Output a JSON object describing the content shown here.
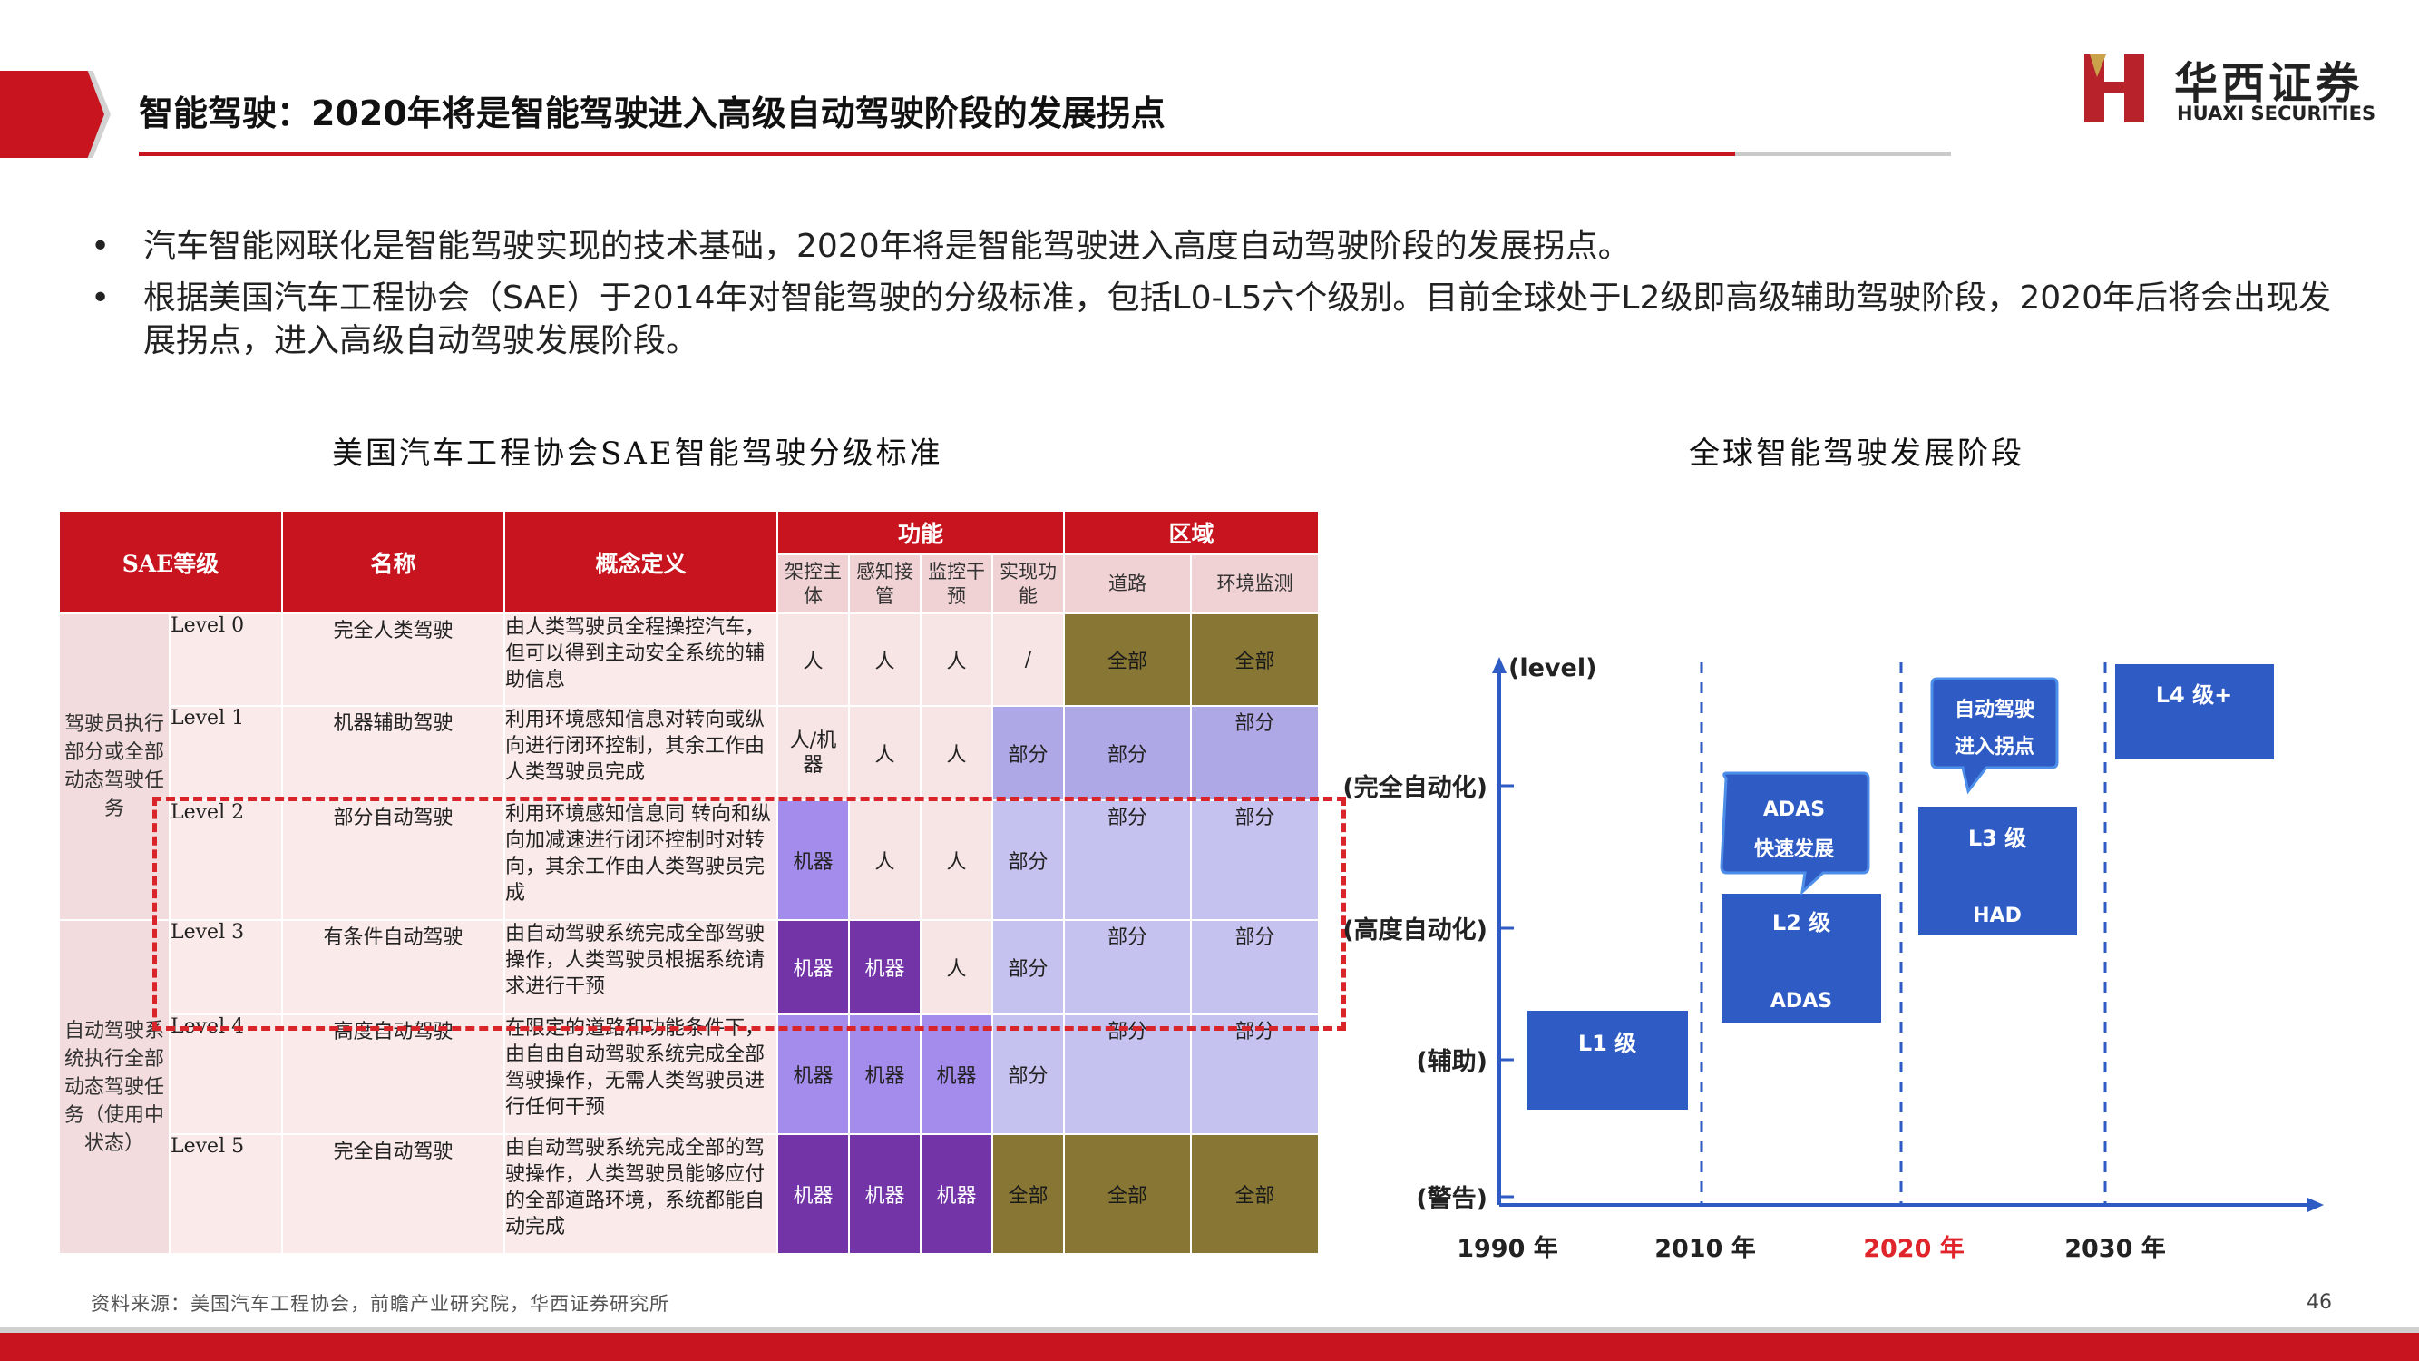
{
  "header": {
    "title": "智能驾驶：2020年将是智能驾驶进入高级自动驾驶阶段的发展拐点",
    "logo_cn": "华西证券",
    "logo_en": "HUAXI SECURITIES"
  },
  "bullets": [
    "汽车智能网联化是智能驾驶实现的技术基础，2020年将是智能驾驶进入高度自动驾驶阶段的发展拐点。",
    "根据美国汽车工程协会（SAE）于2014年对智能驾驶的分级标准，包括L0-L5六个级别。目前全球处于L2级即高级辅助驾驶阶段，2020年后将会出现发展拐点，进入高级自动驾驶发展阶段。"
  ],
  "table": {
    "caption": "美国汽车工程协会SAE智能驾驶分级标准",
    "headers": {
      "level": "SAE等级",
      "name": "名称",
      "definition": "概念定义",
      "function": "功能",
      "region": "区域",
      "sub": [
        "架控主体",
        "感知接管",
        "监控干预",
        "实现功能",
        "道路",
        "环境监测"
      ]
    },
    "groups": [
      "驾驶员执行部分或全部动态驾驶任务",
      "自动驾驶系统执行全部动态驾驶任务（使用中状态）"
    ],
    "rows": [
      {
        "level": "Level 0",
        "name": "完全人类驾驶",
        "def": "由人类驾驶员全程操控汽车，但可以得到主动安全系统的辅助信息",
        "cells": [
          "人",
          "人",
          "人",
          "/",
          "全部",
          "全部"
        ]
      },
      {
        "level": "Level 1",
        "name": "机器辅助驾驶",
        "def": "利用环境感知信息对转向或纵向进行闭环控制，其余工作由人类驾驶员完成",
        "cells": [
          "人/机器",
          "人",
          "人",
          "部分",
          "部分",
          "部分"
        ]
      },
      {
        "level": "Level 2",
        "name": "部分自动驾驶",
        "def": "利用环境感知信息同 转向和纵向加减速进行闭环控制时对转向，其余工作由人类驾驶员完成",
        "cells": [
          "机器",
          "人",
          "人",
          "部分",
          "部分",
          "部分"
        ]
      },
      {
        "level": "Level 3",
        "name": "有条件自动驾驶",
        "def": "由自动驾驶系统完成全部驾驶操作，人类驾驶员根据系统请求进行干预",
        "cells": [
          "机器",
          "机器",
          "人",
          "部分",
          "部分",
          "部分"
        ]
      },
      {
        "level": "Level 4",
        "name": "高度自动驾驶",
        "def": "在限定的道路和功能条件下，由自由自动驾驶系统完成全部驾驶操作，无需人类驾驶员进行任何干预",
        "cells": [
          "机器",
          "机器",
          "机器",
          "部分",
          "部分",
          "部分"
        ]
      },
      {
        "level": "Level 5",
        "name": "完全自动驾驶",
        "def": "由自动驾驶系统完成全部的驾驶操作，人类驾驶员能够应付的全部道路环境，系统都能自动完成",
        "cells": [
          "机器",
          "机器",
          "机器",
          "全部",
          "全部",
          "全部"
        ]
      }
    ]
  },
  "diagram": {
    "caption": "全球智能驾驶发展阶段",
    "y_axis_label": "(level)",
    "y_levels": [
      "(完全自动化)",
      "(高度自动化)",
      "(辅助)",
      "(警告)"
    ],
    "x_years": [
      "1990 年",
      "2010 年",
      "2020 年",
      "2030 年"
    ],
    "boxes": {
      "l1": "L1 级",
      "l2_top": "L2 级",
      "l2_bottom": "ADAS",
      "l3_top": "L3 级",
      "l3_bottom": "HAD",
      "l4": "L4 级+"
    },
    "callouts": {
      "adas_1": "ADAS",
      "adas_2": "快速发展",
      "inflect_1": "自动驾驶",
      "inflect_2": "进入拐点"
    },
    "colors": {
      "box": "#2f5bc4",
      "highlight_year": "#e0242b"
    }
  },
  "footer": {
    "source": "资料来源：美国汽车工程协会，前瞻产业研究院，华西证券研究所",
    "page": "46"
  }
}
